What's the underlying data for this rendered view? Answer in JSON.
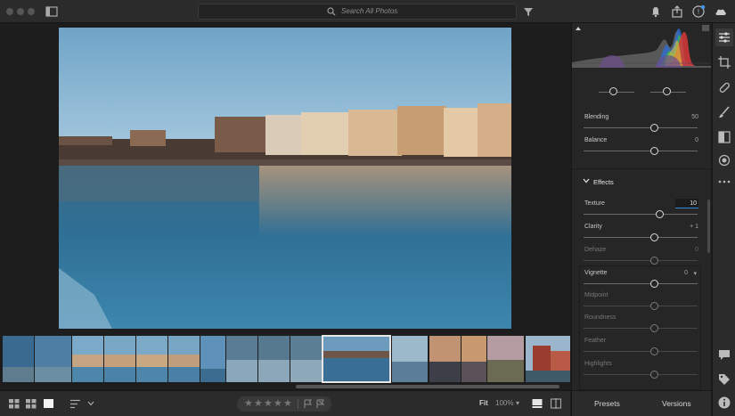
{
  "search": {
    "placeholder": "Search All Photos"
  },
  "panel": {
    "sliders": [
      {
        "label": "Blending",
        "value": "50",
        "pos": 0.62,
        "dim": false
      },
      {
        "label": "Balance",
        "value": "0",
        "pos": 0.62,
        "dim": false
      }
    ],
    "effects_title": "Effects",
    "effects": [
      {
        "label": "Texture",
        "value": "10",
        "pos": 0.67,
        "dim": false,
        "boxed": true
      },
      {
        "label": "Clarity",
        "value": "+ 1",
        "pos": 0.62,
        "dim": false
      },
      {
        "label": "Dehaze",
        "value": "0",
        "pos": 0.62,
        "dim": true
      },
      {
        "label": "Vignette",
        "value": "0",
        "pos": 0.62,
        "dim": false,
        "dropdown": true
      },
      {
        "label": "Midpoint",
        "value": "",
        "pos": 0.62,
        "dim": true
      },
      {
        "label": "Roundness",
        "value": "",
        "pos": 0.62,
        "dim": true
      },
      {
        "label": "Feather",
        "value": "",
        "pos": 0.62,
        "dim": true
      },
      {
        "label": "Highlights",
        "value": "",
        "pos": 0.62,
        "dim": true
      }
    ]
  },
  "tabs": {
    "presets": "Presets",
    "versions": "Versions"
  },
  "bottom": {
    "fit": "Fit",
    "zoom": "100%",
    "zoom_arrow": "▾"
  },
  "rating": {
    "stars": 5,
    "value": 0
  },
  "colors": {
    "accent": "#2e86de",
    "badge": "#4a90e2"
  }
}
